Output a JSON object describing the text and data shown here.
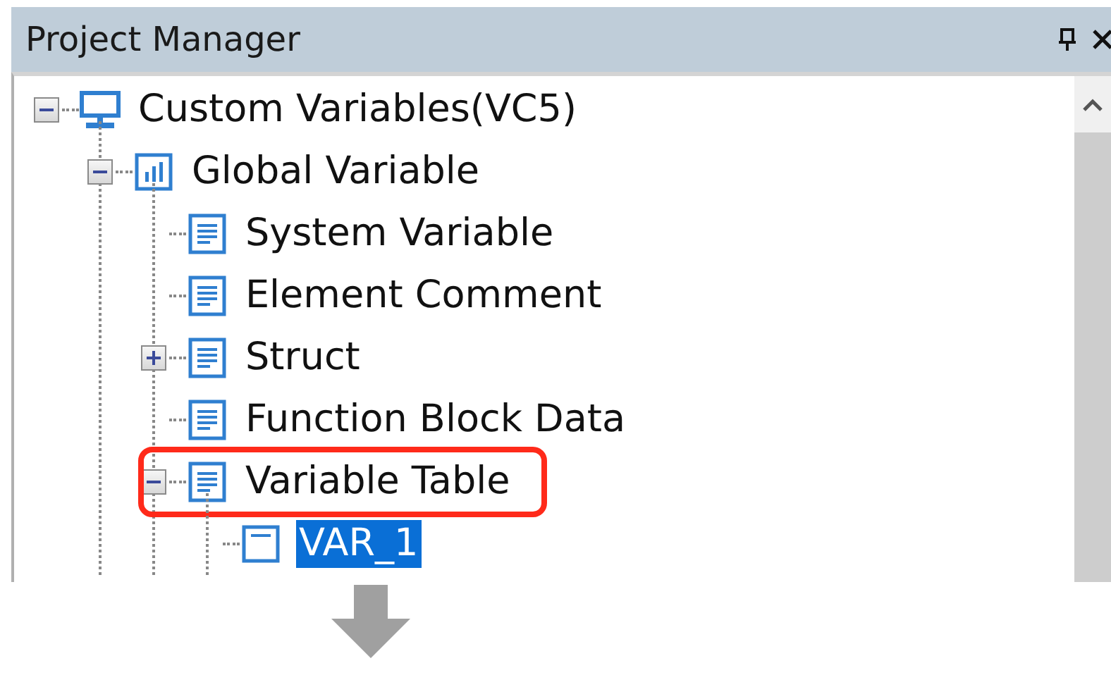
{
  "panel": {
    "title": "Project Manager",
    "buttons": [
      {
        "kind": "pin"
      },
      {
        "kind": "close"
      }
    ]
  },
  "tree": [
    {
      "label": "Custom Variables(VC5)",
      "kind": "computer",
      "expanded": true,
      "selected": false,
      "highlighted": false,
      "children": [
        {
          "label": "Global Variable",
          "kind": "chart",
          "expanded": true,
          "selected": false,
          "highlighted": false,
          "children": [
            {
              "label": "System Variable",
              "kind": "document",
              "selected": false,
              "highlighted": false
            },
            {
              "label": "Element Comment",
              "kind": "document",
              "selected": false,
              "highlighted": false
            },
            {
              "label": "Struct",
              "kind": "document",
              "expanded": false,
              "selected": false,
              "highlighted": false
            },
            {
              "label": "Function Block Data",
              "kind": "document",
              "selected": false,
              "highlighted": false
            },
            {
              "label": "Variable Table",
              "kind": "document",
              "expanded": true,
              "selected": false,
              "highlighted": true,
              "children": [
                {
                  "label": "VAR_1",
                  "kind": "variable",
                  "selected": true,
                  "highlighted": false
                }
              ]
            }
          ]
        }
      ]
    }
  ]
}
